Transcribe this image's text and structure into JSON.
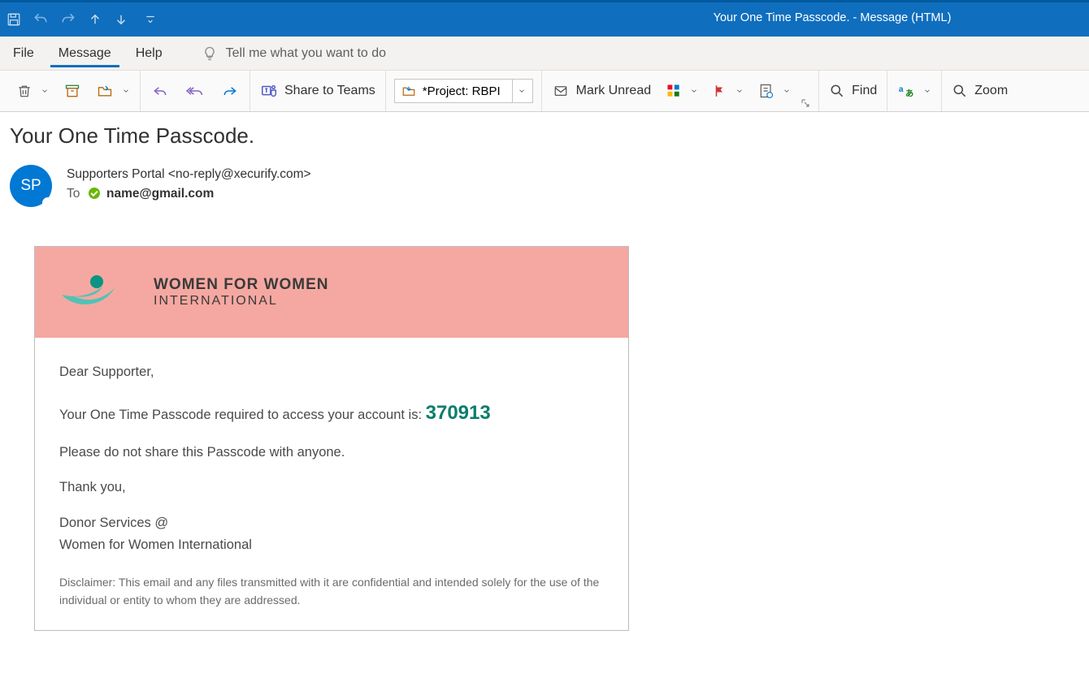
{
  "window": {
    "title": "Your One Time Passcode.  -  Message (HTML)"
  },
  "tabs": {
    "file": "File",
    "message": "Message",
    "help": "Help",
    "tellme": "Tell me what you want to do"
  },
  "ribbon": {
    "share_teams": "Share to Teams",
    "project": "*Project: RBPI",
    "mark_unread": "Mark Unread",
    "find": "Find",
    "zoom": "Zoom"
  },
  "mail": {
    "subject": "Your One Time Passcode.",
    "avatar_initials": "SP",
    "from": "Supporters Portal <no-reply@xecurify.com>",
    "to_label": "To",
    "to_addr": "name@gmail.com"
  },
  "content": {
    "logo_line1": "WOMEN FOR WOMEN",
    "logo_line2": "INTERNATIONAL",
    "greeting": "Dear Supporter,",
    "otp_intro": "Your One Time Passcode required to access your account is: ",
    "otp_code": "370913",
    "no_share": "Please do not share this Passcode with anyone.",
    "thanks": "Thank you,",
    "sig1": "Donor Services @",
    "sig2": "Women for Women International",
    "disclaimer": "Disclaimer: This email and any files transmitted with it are confidential and intended solely for the use of the individual or entity to whom they are addressed."
  }
}
